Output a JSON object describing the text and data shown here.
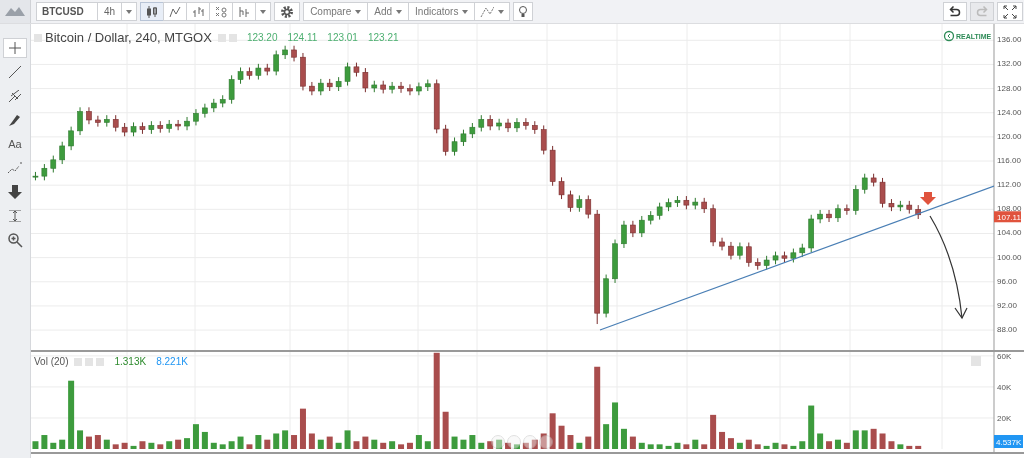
{
  "toolbar": {
    "symbol": "BTCUSD",
    "interval": "4h",
    "chart_styles": [
      {
        "kind": "candles",
        "selected": true
      },
      {
        "kind": "line",
        "selected": false
      },
      {
        "kind": "bars",
        "selected": false
      },
      {
        "kind": "point-figure",
        "selected": false
      },
      {
        "kind": "renko",
        "selected": false
      }
    ],
    "menus": [
      "Compare",
      "Add",
      "Indicators"
    ],
    "history": [
      {
        "kind": "undo",
        "disabled": false
      },
      {
        "kind": "redo",
        "disabled": true
      }
    ]
  },
  "left_toolbar": [
    {
      "kind": "crosshair",
      "selected": true
    },
    {
      "kind": "trend-line",
      "selected": false
    },
    {
      "kind": "pitchfork",
      "selected": false
    },
    {
      "kind": "brush",
      "selected": false
    },
    {
      "kind": "text",
      "label": "Aa",
      "selected": false
    },
    {
      "kind": "pattern",
      "selected": false
    },
    {
      "kind": "arrow",
      "selected": false
    },
    {
      "kind": "measure",
      "selected": false
    },
    {
      "kind": "zoom",
      "selected": false
    }
  ],
  "price_pane": {
    "title": "Bitcoin / Dollar, 240, MTGOX",
    "ohlc": [
      "123.20",
      "124.11",
      "123.01",
      "123.21"
    ],
    "realtime": "REALTIME",
    "last_price": "107.11",
    "chart_data": {
      "type": "candlestick",
      "grid": true,
      "ylim": [
        84.7,
        138.7
      ],
      "categories": [
        null,
        null,
        null,
        null,
        null,
        null,
        null,
        null,
        null,
        null,
        null,
        null,
        null,
        null,
        null,
        null,
        null,
        null,
        null,
        null,
        null,
        null,
        null,
        null,
        null,
        null,
        null,
        null,
        null,
        null,
        null,
        null,
        null,
        null,
        null,
        null,
        null,
        null,
        null,
        null,
        null,
        null,
        null,
        null,
        null,
        null,
        null,
        null,
        null,
        null,
        null,
        null,
        null,
        null,
        null,
        null,
        null,
        null,
        null,
        null,
        null,
        null,
        null,
        null,
        null,
        null,
        null,
        null,
        null,
        null,
        null,
        null,
        null,
        null,
        null,
        null,
        null,
        null,
        null,
        null,
        null,
        null,
        null,
        null,
        null,
        null,
        null,
        null,
        null,
        null,
        null,
        null,
        null,
        null,
        null,
        null,
        null,
        null,
        null,
        null,
        null,
        null,
        null,
        null,
        null,
        null,
        null,
        null
      ],
      "yticks": [
        {
          "value": 136,
          "label": "136.00"
        },
        {
          "value": 132,
          "label": "132.00"
        },
        {
          "value": 128,
          "label": "128.00"
        },
        {
          "value": 124,
          "label": "124.00"
        },
        {
          "value": 120,
          "label": "120.00"
        },
        {
          "value": 116,
          "label": "116.00"
        },
        {
          "value": 112,
          "label": "112.00"
        },
        {
          "value": 108,
          "label": "108.00"
        },
        {
          "value": 104,
          "label": "104.00"
        },
        {
          "value": 100,
          "label": "100.00"
        },
        {
          "value": 96,
          "label": "96.00"
        },
        {
          "value": 92,
          "label": "92.00"
        },
        {
          "value": 88,
          "label": "88.00"
        }
      ],
      "ohlc": [
        [
          113.5,
          114.2,
          112.8,
          113.5
        ],
        [
          113.5,
          115.5,
          112.8,
          114.8
        ],
        [
          114.8,
          116.9,
          114.1,
          116.2
        ],
        [
          116.2,
          119.2,
          115.5,
          118.5
        ],
        [
          118.5,
          121.7,
          117.8,
          121.0
        ],
        [
          121.0,
          124.9,
          120.3,
          124.2
        ],
        [
          124.2,
          124.9,
          122.1,
          122.8
        ],
        [
          122.8,
          123.5,
          121.7,
          122.4
        ],
        [
          122.4,
          123.6,
          121.7,
          122.9
        ],
        [
          122.9,
          123.6,
          120.9,
          121.6
        ],
        [
          121.6,
          122.3,
          120.1,
          120.8
        ],
        [
          120.8,
          122.4,
          120.1,
          121.7
        ],
        [
          121.7,
          122.4,
          120.5,
          121.2
        ],
        [
          121.2,
          122.6,
          120.5,
          121.9
        ],
        [
          121.9,
          122.6,
          120.7,
          121.4
        ],
        [
          121.4,
          122.8,
          120.7,
          122.1
        ],
        [
          122.1,
          122.8,
          121.1,
          121.8
        ],
        [
          121.8,
          123.3,
          121.1,
          122.6
        ],
        [
          122.6,
          124.6,
          121.9,
          123.9
        ],
        [
          123.9,
          125.5,
          123.2,
          124.8
        ],
        [
          124.8,
          126.3,
          124.1,
          125.6
        ],
        [
          125.6,
          126.9,
          124.9,
          126.2
        ],
        [
          126.2,
          130.2,
          125.5,
          129.5
        ],
        [
          129.5,
          131.5,
          128.8,
          130.8
        ],
        [
          130.8,
          131.5,
          129.5,
          130.2
        ],
        [
          130.2,
          132.1,
          129.5,
          131.4
        ],
        [
          131.4,
          132.1,
          130.2,
          130.9
        ],
        [
          130.9,
          134.3,
          130.2,
          133.6
        ],
        [
          133.6,
          135.1,
          132.9,
          134.4
        ],
        [
          134.4,
          135.1,
          132.5,
          133.2
        ],
        [
          133.2,
          133.9,
          127.7,
          128.4
        ],
        [
          128.4,
          129.1,
          126.9,
          127.6
        ],
        [
          127.6,
          129.6,
          126.9,
          128.9
        ],
        [
          128.9,
          129.6,
          127.6,
          128.3
        ],
        [
          128.3,
          129.9,
          127.6,
          129.2
        ],
        [
          129.2,
          132.3,
          128.5,
          131.6
        ],
        [
          131.6,
          132.3,
          130.0,
          130.7
        ],
        [
          130.7,
          131.4,
          127.4,
          128.1
        ],
        [
          128.1,
          129.3,
          127.4,
          128.6
        ],
        [
          128.6,
          129.3,
          127.2,
          127.9
        ],
        [
          127.9,
          129.1,
          127.2,
          128.4
        ],
        [
          128.4,
          129.1,
          127.3,
          128.0
        ],
        [
          128.0,
          128.7,
          126.9,
          127.6
        ],
        [
          127.6,
          129.0,
          126.9,
          128.3
        ],
        [
          128.3,
          129.5,
          127.6,
          128.8
        ],
        [
          128.8,
          129.5,
          120.6,
          121.3
        ],
        [
          121.3,
          122.0,
          116.9,
          117.6
        ],
        [
          117.6,
          119.9,
          116.9,
          119.2
        ],
        [
          119.2,
          121.2,
          118.5,
          120.5
        ],
        [
          120.5,
          122.3,
          119.8,
          121.6
        ],
        [
          121.6,
          123.6,
          120.9,
          122.9
        ],
        [
          122.9,
          123.6,
          121.1,
          121.8
        ],
        [
          121.8,
          123.0,
          121.1,
          122.3
        ],
        [
          122.3,
          123.0,
          120.8,
          121.5
        ],
        [
          121.5,
          123.1,
          120.8,
          122.4
        ],
        [
          122.4,
          123.1,
          121.2,
          121.9
        ],
        [
          121.9,
          122.6,
          120.5,
          121.2
        ],
        [
          121.2,
          121.9,
          117.1,
          117.8
        ],
        [
          117.8,
          118.5,
          111.9,
          112.6
        ],
        [
          112.6,
          113.3,
          109.7,
          110.4
        ],
        [
          110.4,
          111.1,
          107.6,
          108.3
        ],
        [
          108.3,
          110.3,
          107.6,
          109.6
        ],
        [
          109.6,
          110.3,
          106.5,
          107.2
        ],
        [
          107.2,
          107.9,
          89.0,
          90.8
        ],
        [
          90.8,
          97.2,
          90.1,
          96.5
        ],
        [
          96.5,
          103.0,
          95.8,
          102.3
        ],
        [
          102.3,
          106.1,
          101.6,
          105.4
        ],
        [
          105.4,
          106.1,
          103.4,
          104.1
        ],
        [
          104.1,
          106.9,
          103.4,
          106.2
        ],
        [
          106.2,
          107.7,
          105.5,
          107.0
        ],
        [
          107.0,
          109.1,
          106.3,
          108.4
        ],
        [
          108.4,
          109.8,
          107.7,
          109.1
        ],
        [
          109.1,
          110.2,
          108.4,
          109.5
        ],
        [
          109.5,
          110.2,
          108.0,
          108.7
        ],
        [
          108.7,
          109.9,
          108.0,
          109.2
        ],
        [
          109.2,
          109.9,
          107.4,
          108.1
        ],
        [
          108.1,
          108.8,
          101.9,
          102.6
        ],
        [
          102.6,
          103.3,
          101.2,
          101.9
        ],
        [
          101.9,
          102.6,
          99.7,
          100.4
        ],
        [
          100.4,
          102.5,
          99.7,
          101.8
        ],
        [
          101.8,
          102.5,
          98.5,
          99.2
        ],
        [
          99.2,
          99.9,
          98.0,
          98.7
        ],
        [
          98.7,
          100.3,
          98.0,
          99.6
        ],
        [
          99.6,
          101.0,
          98.9,
          100.3
        ],
        [
          100.3,
          101.0,
          99.2,
          99.9
        ],
        [
          99.9,
          101.5,
          99.2,
          100.8
        ],
        [
          100.8,
          102.3,
          100.1,
          101.6
        ],
        [
          101.6,
          107.1,
          100.9,
          106.4
        ],
        [
          106.4,
          107.9,
          105.7,
          107.2
        ],
        [
          107.2,
          107.9,
          105.9,
          106.6
        ],
        [
          106.6,
          108.8,
          105.9,
          108.1
        ],
        [
          108.1,
          108.8,
          107.1,
          107.8
        ],
        [
          107.8,
          112.0,
          107.1,
          111.3
        ],
        [
          111.3,
          113.9,
          110.6,
          113.2
        ],
        [
          113.2,
          113.9,
          111.8,
          112.5
        ],
        [
          112.5,
          113.2,
          108.3,
          109.0
        ],
        [
          109.0,
          109.7,
          107.7,
          108.4
        ],
        [
          108.4,
          109.4,
          107.7,
          108.7
        ],
        [
          108.7,
          109.4,
          107.3,
          108.0
        ],
        [
          108.0,
          108.7,
          106.4,
          107.1
        ],
        null,
        null,
        null,
        null,
        null,
        null,
        null,
        null
      ]
    }
  },
  "volume_pane": {
    "title": "Vol (20)",
    "readings": [
      {
        "text": "1.313K",
        "color": "#2e8b2e"
      },
      {
        "text": "8.221K",
        "color": "#2196f3"
      }
    ],
    "last_volume": "4.537K",
    "chart_data": {
      "type": "bar",
      "grid": true,
      "stacked": true,
      "ylim": [
        0,
        62.5
      ],
      "yticks": [
        {
          "value": 60,
          "label": "60K"
        },
        {
          "value": 40,
          "label": "40K"
        },
        {
          "value": 20,
          "label": "20K"
        }
      ],
      "categories": [
        null,
        null,
        null,
        null,
        null,
        null,
        null,
        null,
        null,
        null,
        null,
        null,
        null,
        null,
        null,
        null,
        null,
        null,
        null,
        null,
        null,
        null,
        null,
        null,
        null,
        null,
        null,
        null,
        null,
        null,
        null,
        null,
        null,
        null,
        null,
        null,
        null,
        null,
        null,
        null,
        null,
        null,
        null,
        null,
        null,
        null,
        null,
        null,
        null,
        null,
        null,
        null,
        null,
        null,
        null,
        null,
        null,
        null,
        null,
        null,
        null,
        null,
        null,
        null,
        null,
        null,
        null,
        null,
        null,
        null,
        null,
        null,
        null,
        null,
        null,
        null,
        null,
        null,
        null,
        null,
        null,
        null,
        null,
        null,
        null,
        null,
        null,
        null,
        null,
        null,
        null,
        null,
        null,
        null,
        null,
        null,
        null,
        null,
        null,
        null,
        null,
        null,
        null,
        null,
        null,
        null,
        null,
        null
      ],
      "series": [
        {
          "color": "#3d9b3d",
          "values": [
            5,
            9,
            4,
            6,
            44,
            12,
            null,
            null,
            6,
            null,
            null,
            2,
            null,
            4,
            null,
            5,
            null,
            7,
            16,
            11,
            4,
            3,
            5,
            8,
            null,
            9,
            null,
            10,
            12,
            null,
            null,
            null,
            6,
            null,
            4,
            12,
            null,
            null,
            6,
            null,
            5,
            null,
            null,
            9,
            5,
            null,
            null,
            8,
            6,
            9,
            4,
            null,
            6,
            null,
            3,
            null,
            null,
            null,
            null,
            null,
            null,
            4,
            null,
            null,
            16,
            30,
            13,
            null,
            4,
            3,
            3,
            2,
            4,
            null,
            6,
            null,
            null,
            null,
            null,
            4,
            null,
            null,
            2,
            4,
            null,
            2,
            5,
            28,
            10,
            null,
            6,
            null,
            12,
            12,
            null,
            null,
            null,
            3,
            null,
            null,
            null,
            null,
            null,
            null,
            null,
            null,
            null,
            null
          ]
        },
        {
          "color": "#a94d4d",
          "values": [
            null,
            null,
            null,
            null,
            null,
            null,
            8,
            9,
            null,
            3,
            4,
            null,
            5,
            null,
            3,
            null,
            6,
            null,
            null,
            null,
            null,
            null,
            null,
            null,
            3,
            null,
            6,
            null,
            null,
            9,
            26,
            10,
            null,
            8,
            null,
            null,
            5,
            8,
            null,
            4,
            null,
            3,
            4,
            null,
            null,
            62,
            24,
            null,
            null,
            null,
            null,
            5,
            null,
            4,
            null,
            4,
            6,
            10,
            23,
            15,
            9,
            null,
            8,
            53,
            null,
            null,
            null,
            8,
            null,
            null,
            null,
            null,
            null,
            3,
            null,
            3,
            22,
            11,
            7,
            null,
            6,
            3,
            null,
            null,
            3,
            null,
            null,
            null,
            null,
            5,
            null,
            4,
            null,
            null,
            13,
            10,
            5,
            null,
            2,
            2,
            null,
            null,
            null,
            null,
            null,
            null,
            null,
            null
          ]
        }
      ]
    }
  }
}
